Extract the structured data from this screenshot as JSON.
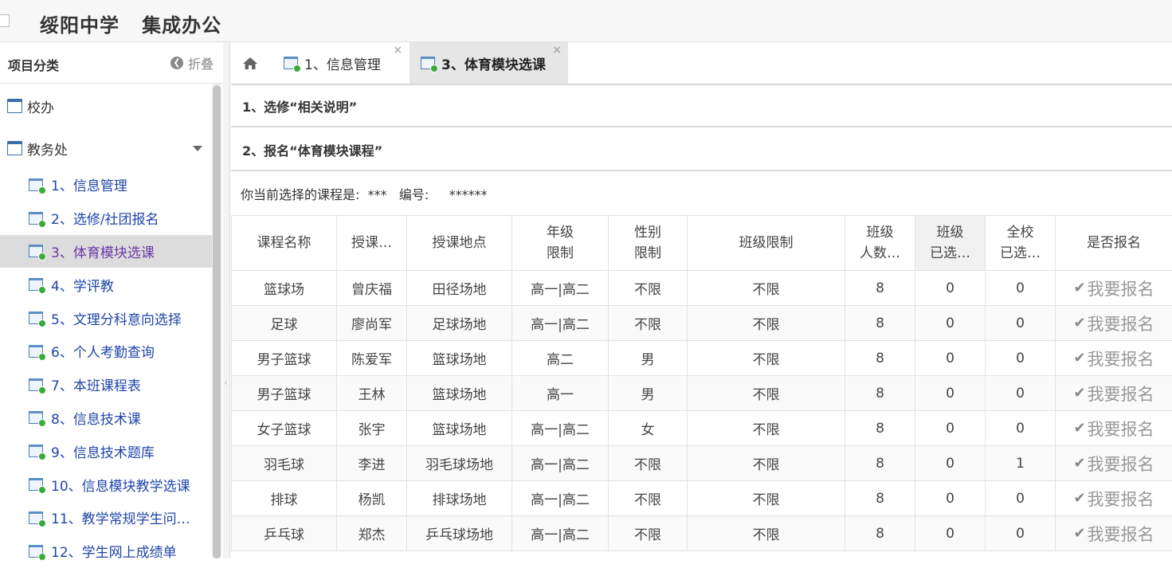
{
  "header": {
    "app_title": "绥阳中学   集成办公"
  },
  "sidebar": {
    "title": "项目分类",
    "collapse_label": "折叠",
    "categories": [
      {
        "label": "校办",
        "icon": "window-icon"
      },
      {
        "label": "教务处",
        "icon": "window-icon",
        "expanded": true
      }
    ],
    "items": [
      {
        "label": "1、信息管理"
      },
      {
        "label": "2、选修/社团报名"
      },
      {
        "label": "3、体育模块选课",
        "active": true
      },
      {
        "label": "4、学评教"
      },
      {
        "label": "5、文理分科意向选择"
      },
      {
        "label": "6、个人考勤查询"
      },
      {
        "label": "7、本班课程表"
      },
      {
        "label": "8、信息技术课"
      },
      {
        "label": "9、信息技术题库"
      },
      {
        "label": "10、信息模块教学选课"
      },
      {
        "label": "11、教学常规学生问…"
      },
      {
        "label": "12、学生网上成绩单"
      }
    ]
  },
  "tabs": [
    {
      "label": "1、信息管理",
      "close": "×"
    },
    {
      "label": "3、体育模块选课",
      "close": "×",
      "active": true
    }
  ],
  "main": {
    "section1": "1、选修“相关说明”",
    "section2": "2、报名“体育模块课程”",
    "current_choice": "你当前选择的课程是:  ***   编号:     ******",
    "table": {
      "headers": [
        [
          "课程名称"
        ],
        [
          "授课…"
        ],
        [
          "授课地点"
        ],
        [
          "年级",
          "限制"
        ],
        [
          "性别",
          "限制"
        ],
        [
          "班级限制"
        ],
        [
          "班级",
          "人数…"
        ],
        [
          "班级",
          "已选…"
        ],
        [
          "全校",
          "已选…"
        ],
        [
          "是否报名"
        ]
      ],
      "rows": [
        [
          "篮球场",
          "曾庆福",
          "田径场地",
          "高一|高二",
          "不限",
          "不限",
          "8",
          "0",
          "0"
        ],
        [
          "足球",
          "廖尚军",
          "足球场地",
          "高一|高二",
          "不限",
          "不限",
          "8",
          "0",
          "0"
        ],
        [
          "男子篮球",
          "陈爱军",
          "篮球场地",
          "高二",
          "男",
          "不限",
          "8",
          "0",
          "0"
        ],
        [
          "男子篮球",
          "王林",
          "篮球场地",
          "高一",
          "男",
          "不限",
          "8",
          "0",
          "0"
        ],
        [
          "女子篮球",
          "张宇",
          "篮球场地",
          "高一|高二",
          "女",
          "不限",
          "8",
          "0",
          "0"
        ],
        [
          "羽毛球",
          "李进",
          "羽毛球场地",
          "高一|高二",
          "不限",
          "不限",
          "8",
          "0",
          "1"
        ],
        [
          "排球",
          "杨凯",
          "排球场地",
          "高一|高二",
          "不限",
          "不限",
          "8",
          "0",
          "0"
        ],
        [
          "乒乓球",
          "郑杰",
          "乒乓球场地",
          "高一|高二",
          "不限",
          "不限",
          "8",
          "0",
          "0"
        ]
      ],
      "action_label": "我要报名",
      "action_icon": "check-icon"
    }
  }
}
